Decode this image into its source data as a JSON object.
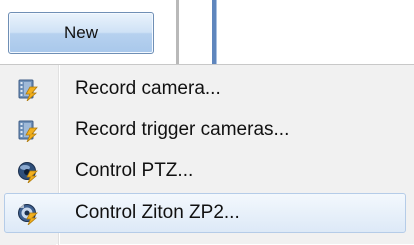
{
  "toolbar": {
    "new_label": "New"
  },
  "menu": {
    "items": [
      {
        "label": "Record camera...",
        "icon": "film-lightning-icon"
      },
      {
        "label": "Record trigger cameras...",
        "icon": "film-lightning-icon"
      },
      {
        "label": "Control PTZ...",
        "icon": "ptz-camera-icon"
      },
      {
        "label": "Control Ziton ZP2...",
        "icon": "ziton-panel-icon",
        "highlighted": true
      }
    ]
  },
  "colors": {
    "highlight_border": "#b5cce8",
    "button_border": "#6f8fb5",
    "accent_blue": "#5f86bd"
  }
}
